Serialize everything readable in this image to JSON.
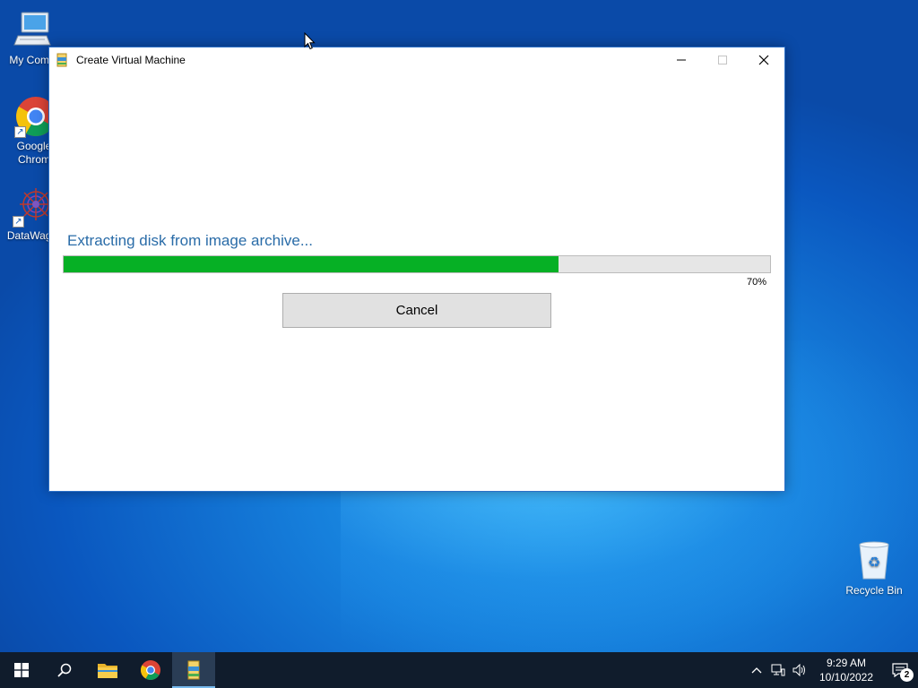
{
  "desktop": {
    "icons": [
      {
        "label": "My Comp",
        "icon": "computer-icon"
      },
      {
        "label": "Google Chrom",
        "icon": "chrome-icon"
      },
      {
        "label": "DataWago",
        "icon": "datawagon-icon"
      },
      {
        "label": "Recycle Bin",
        "icon": "recycle-bin-icon"
      }
    ]
  },
  "window": {
    "title": "Create Virtual Machine",
    "status_text": "Extracting disk from image archive...",
    "progress": {
      "value": 0.7,
      "label": "70%"
    },
    "cancel_label": "Cancel",
    "controls": {
      "minimize": "minimize-icon",
      "maximize": "maximize-icon",
      "close": "close-icon"
    }
  },
  "taskbar": {
    "items": [
      "start-icon",
      "search-icon",
      "file-explorer-icon",
      "chrome-icon",
      "create-vm-app-icon"
    ],
    "clock": {
      "time": "9:29 AM",
      "date": "10/10/2022"
    },
    "notification_count": "2"
  },
  "colors": {
    "progress_fill": "#06b025",
    "status_text": "#2a6ca8",
    "taskbar": "#101c2c"
  }
}
